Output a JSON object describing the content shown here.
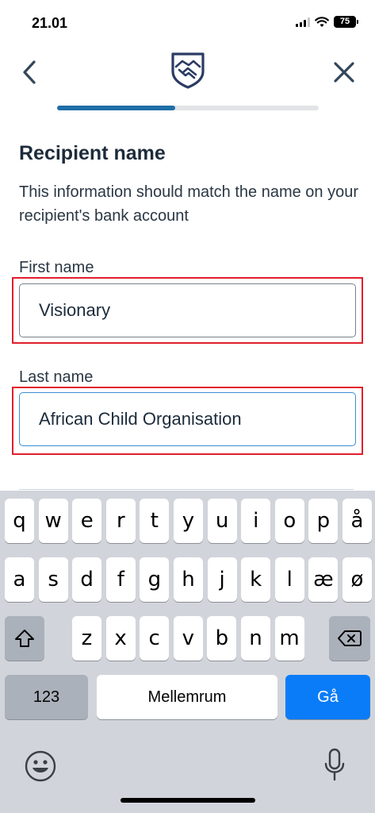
{
  "status_bar": {
    "time": "21.01",
    "battery": "75"
  },
  "header": {
    "back_icon": "chevron-left-icon",
    "logo_icon": "handshake-shield-icon",
    "close_icon": "close-icon"
  },
  "progress": {
    "fraction": 0.45
  },
  "form": {
    "title": "Recipient name",
    "subtitle": "This information should match the name on your recipient's bank account",
    "first_name_label": "First name",
    "first_name_value": "Visionary",
    "last_name_label": "Last name",
    "last_name_value": "African Child Organisation"
  },
  "keyboard": {
    "row1": [
      "q",
      "w",
      "e",
      "r",
      "t",
      "y",
      "u",
      "i",
      "o",
      "p",
      "å"
    ],
    "row2": [
      "a",
      "s",
      "d",
      "f",
      "g",
      "h",
      "j",
      "k",
      "l",
      "æ",
      "ø"
    ],
    "row3": [
      "z",
      "x",
      "c",
      "v",
      "b",
      "n",
      "m"
    ],
    "numbers_key": "123",
    "space_key": "Mellemrum",
    "go_key": "Gå",
    "shift_icon": "shift-icon",
    "delete_icon": "backspace-icon",
    "emoji_icon": "emoji-icon",
    "mic_icon": "microphone-icon"
  },
  "colors": {
    "accent": "#1f6ea7",
    "highlight": "#e0202c",
    "go_key": "#0a7cf7"
  }
}
